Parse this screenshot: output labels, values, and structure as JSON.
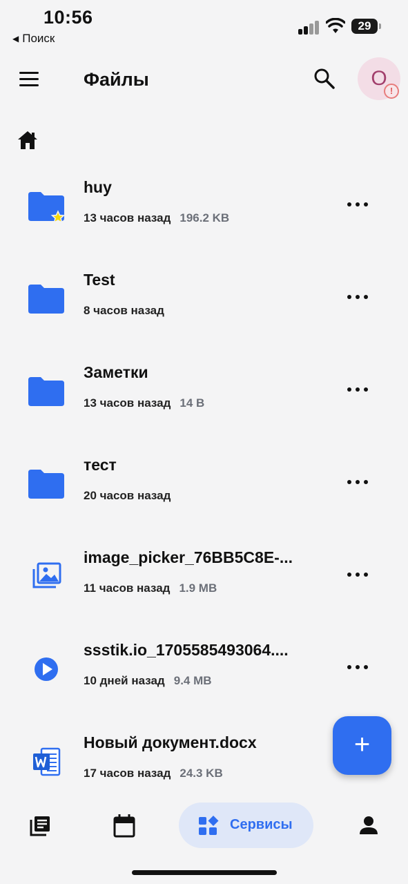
{
  "status_bar": {
    "time": "10:56",
    "back_app": "Поиск",
    "battery": "29"
  },
  "header": {
    "title": "Файлы",
    "avatar_initial": "O",
    "avatar_alert": "!"
  },
  "files": [
    {
      "name": "huy",
      "modified": "13 часов назад",
      "size": "196.2 KB",
      "type": "folder",
      "starred": true
    },
    {
      "name": "Test",
      "modified": "8 часов назад",
      "size": "",
      "type": "folder",
      "starred": false
    },
    {
      "name": "Заметки",
      "modified": "13 часов назад",
      "size": "14 B",
      "type": "folder",
      "starred": false
    },
    {
      "name": "тест",
      "modified": "20 часов назад",
      "size": "",
      "type": "folder",
      "starred": false
    },
    {
      "name": "image_picker_76BB5C8E-...",
      "modified": "11 часов назад",
      "size": "1.9 MB",
      "type": "image",
      "starred": false
    },
    {
      "name": "ssstik.io_1705585493064....",
      "modified": "10 дней назад",
      "size": "9.4 MB",
      "type": "video",
      "starred": false
    },
    {
      "name": "Новый документ.docx",
      "modified": "17 часов назад",
      "size": "24.3 KB",
      "type": "word",
      "starred": false
    }
  ],
  "fab": {
    "label": "+"
  },
  "bottom_nav": {
    "items": [
      "library-icon",
      "calendar-icon",
      "services-icon",
      "person-icon"
    ],
    "services_label": "Сервисы",
    "active": "services"
  },
  "colors": {
    "accent": "#2f6ef0",
    "background": "#f4f4f5",
    "active_pill": "#dfe7f8",
    "star": "#f5d90a"
  }
}
